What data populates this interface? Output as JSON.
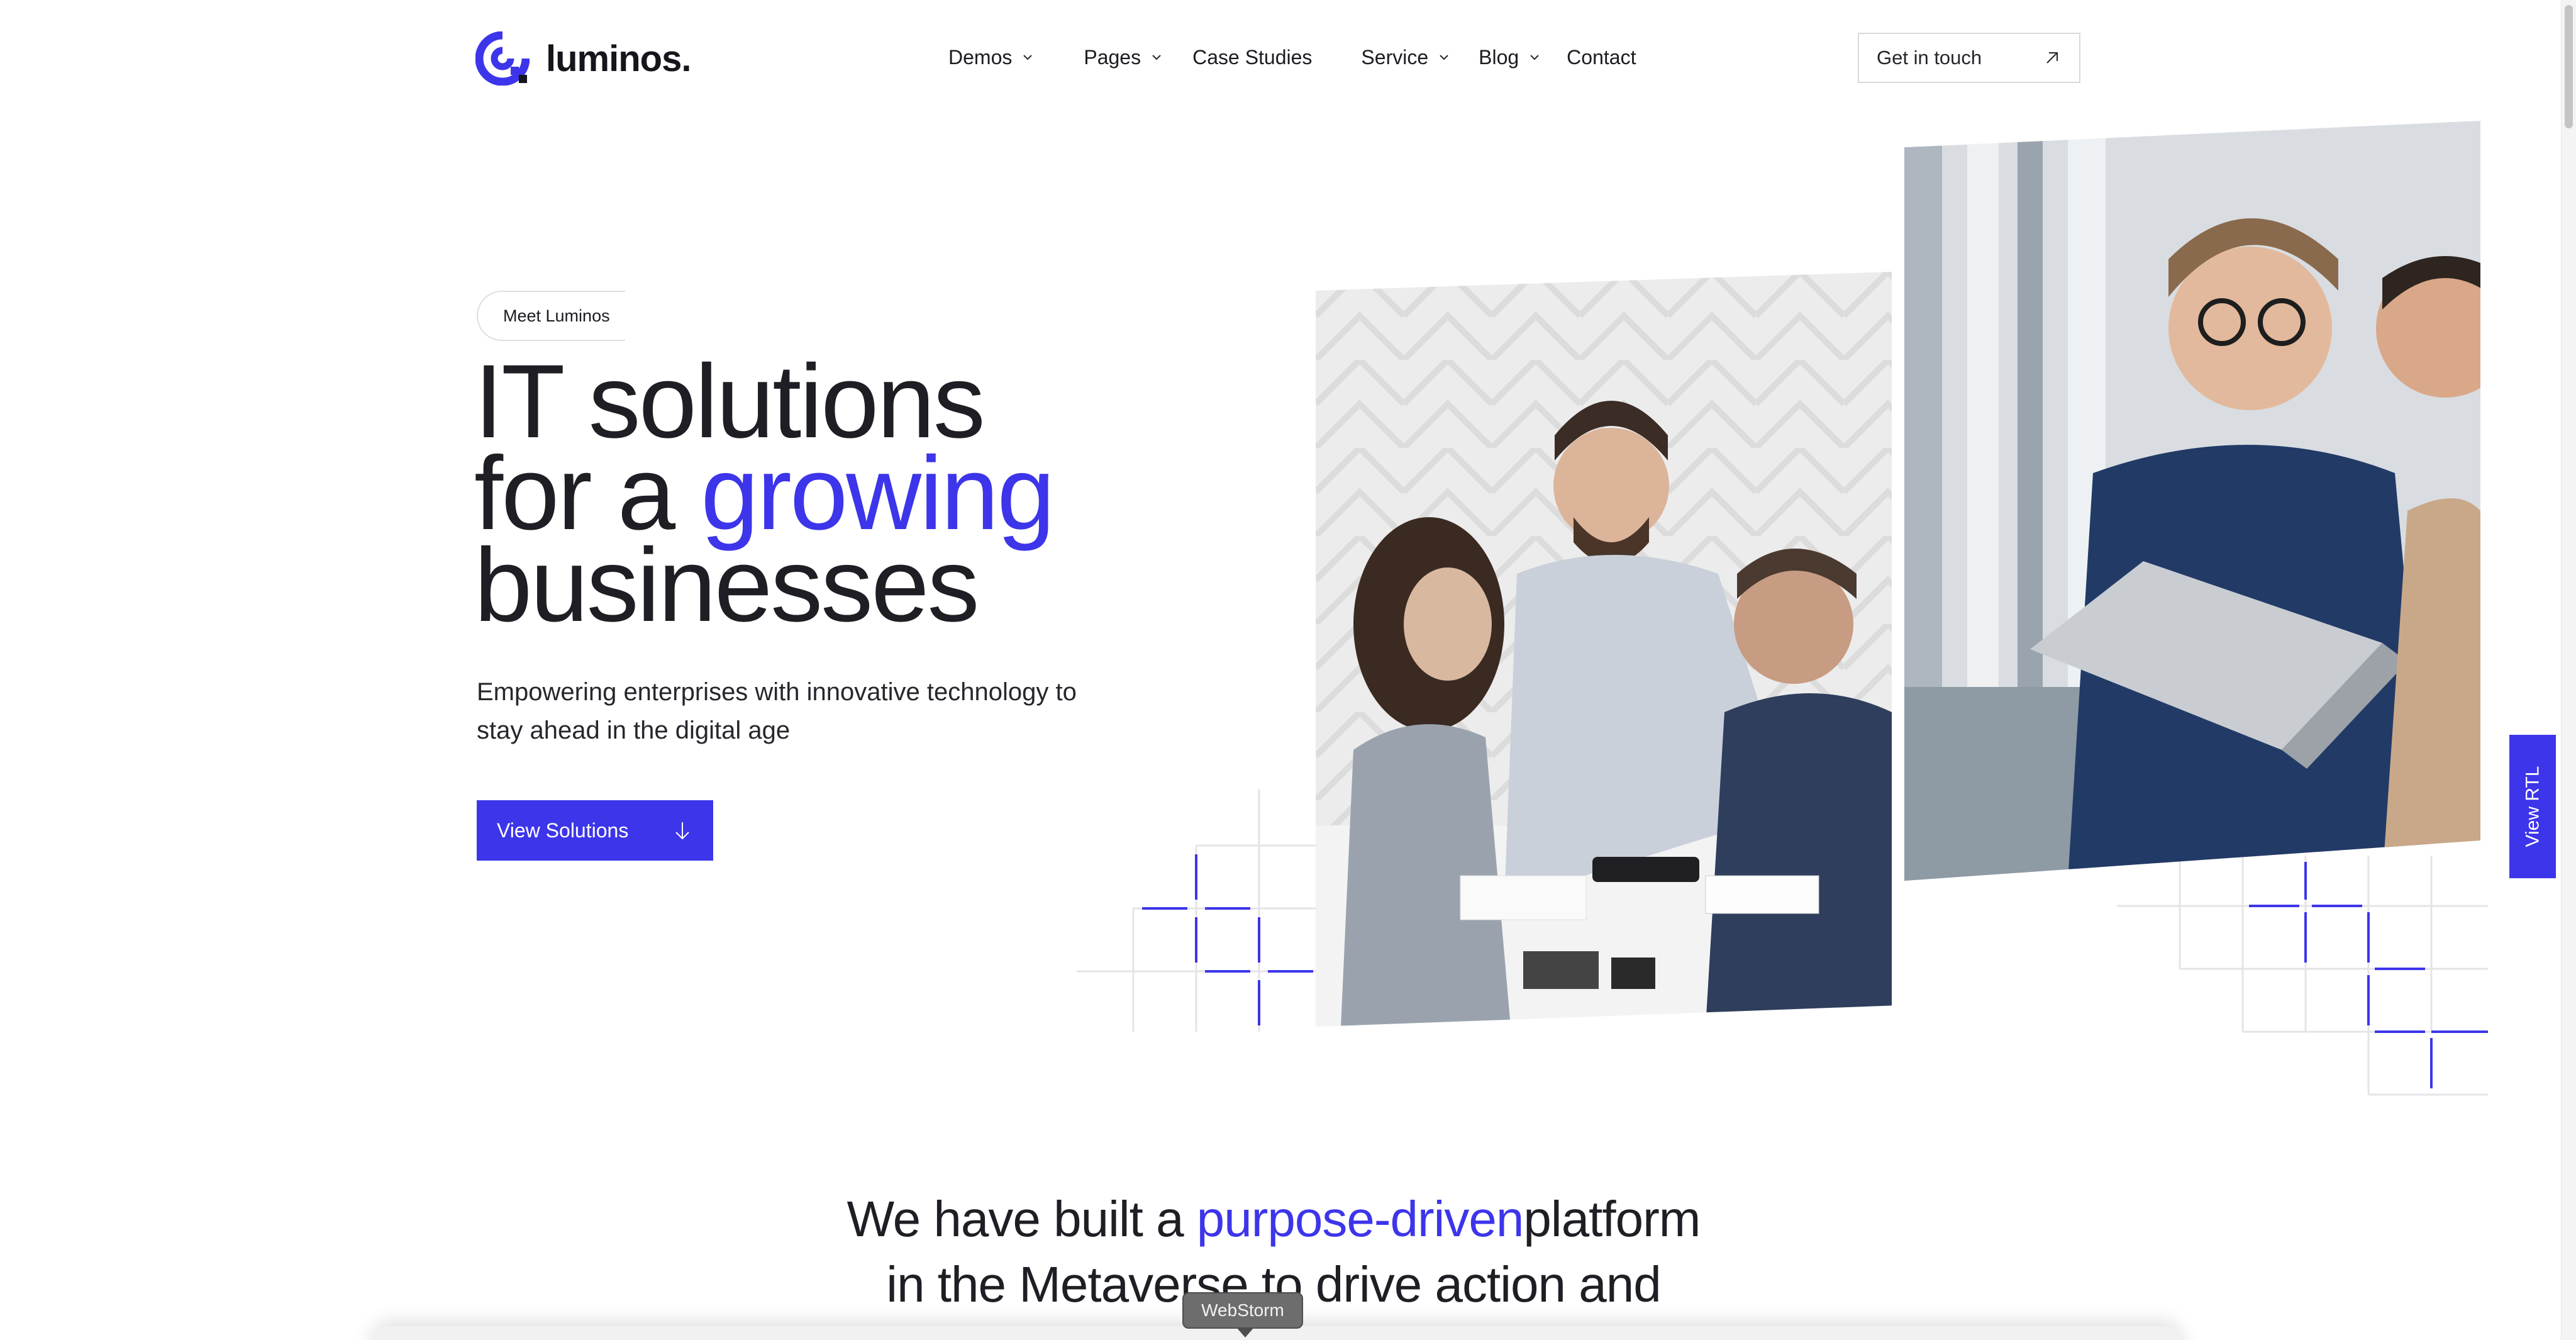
{
  "brand": {
    "name": "luminos.",
    "accent_color": "#3d35ea"
  },
  "nav": {
    "items": [
      {
        "label": "Demos",
        "has_dropdown": true
      },
      {
        "label": "Pages",
        "has_dropdown": true
      },
      {
        "label": "Case Studies",
        "has_dropdown": false
      },
      {
        "label": "Service",
        "has_dropdown": true
      },
      {
        "label": "Blog",
        "has_dropdown": true
      },
      {
        "label": "Contact",
        "has_dropdown": false
      }
    ],
    "cta_label": "Get in touch",
    "cta_icon": "arrow-up-right-icon"
  },
  "hero": {
    "eyebrow": "Meet Luminos",
    "title_line1": "IT solutions",
    "title_line2_pre": "for a ",
    "title_line2_accent": "growing",
    "title_line3": "businesses",
    "subtitle": "Empowering enterprises with innovative technology to stay ahead in the digital age",
    "button_label": "View Solutions",
    "button_icon": "arrow-down-icon",
    "images": [
      {
        "name": "team-meeting-photo"
      },
      {
        "name": "laptop-discussion-photo"
      }
    ]
  },
  "side_tab": {
    "label": "View RTL"
  },
  "statement": {
    "line1_pre": "We have built a ",
    "line1_accent": "purpose-driven",
    "line1_post": "platform",
    "line2": "in the Metaverse to drive action and"
  },
  "tooltip": {
    "label": "WebStorm"
  }
}
